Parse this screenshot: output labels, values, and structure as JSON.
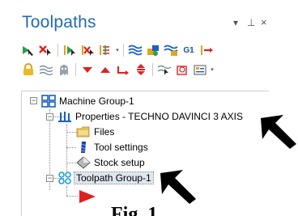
{
  "panel": {
    "title": "Toolpaths",
    "controls": {
      "dropdown": "▾",
      "pin": "⊥",
      "close": "×"
    }
  },
  "toolbar_row1": {
    "icons": [
      "select-all-toolpaths-icon",
      "select-failed-toolpaths-icon",
      "regenerate-selected-icon",
      "regenerate-dirty-icon",
      "toggle-display-icon",
      "backplot-icon",
      "verify-icon",
      "simulate-icon",
      "g1-post-icon",
      "post-selected-icon"
    ],
    "g1_label": "G1"
  },
  "toolbar_row2": {
    "icons": [
      "lock-icon",
      "wave-icon",
      "ghost-icon",
      "move-down-icon",
      "move-up-icon",
      "insert-after-icon",
      "scroll-icon",
      "expand-collapse-icon",
      "toggle-toolpath-icon",
      "options-icon"
    ]
  },
  "tree": {
    "machine_group": "Machine Group-1",
    "properties": "Properties - TECHNO DAVINCI 3 AXIS",
    "files": "Files",
    "tool_settings": "Tool settings",
    "stock_setup": "Stock setup",
    "toolpath_group": "Toolpath Group-1",
    "expand_minus": "−"
  },
  "caption": "Fig. 1",
  "colors": {
    "title_blue": "#1e6bb8",
    "arrow_green": "#2d9e4a",
    "arrow_red": "#e02020",
    "tree_blue": "#1a5fc4",
    "toolpath_cyan": "#1e9fe0"
  }
}
